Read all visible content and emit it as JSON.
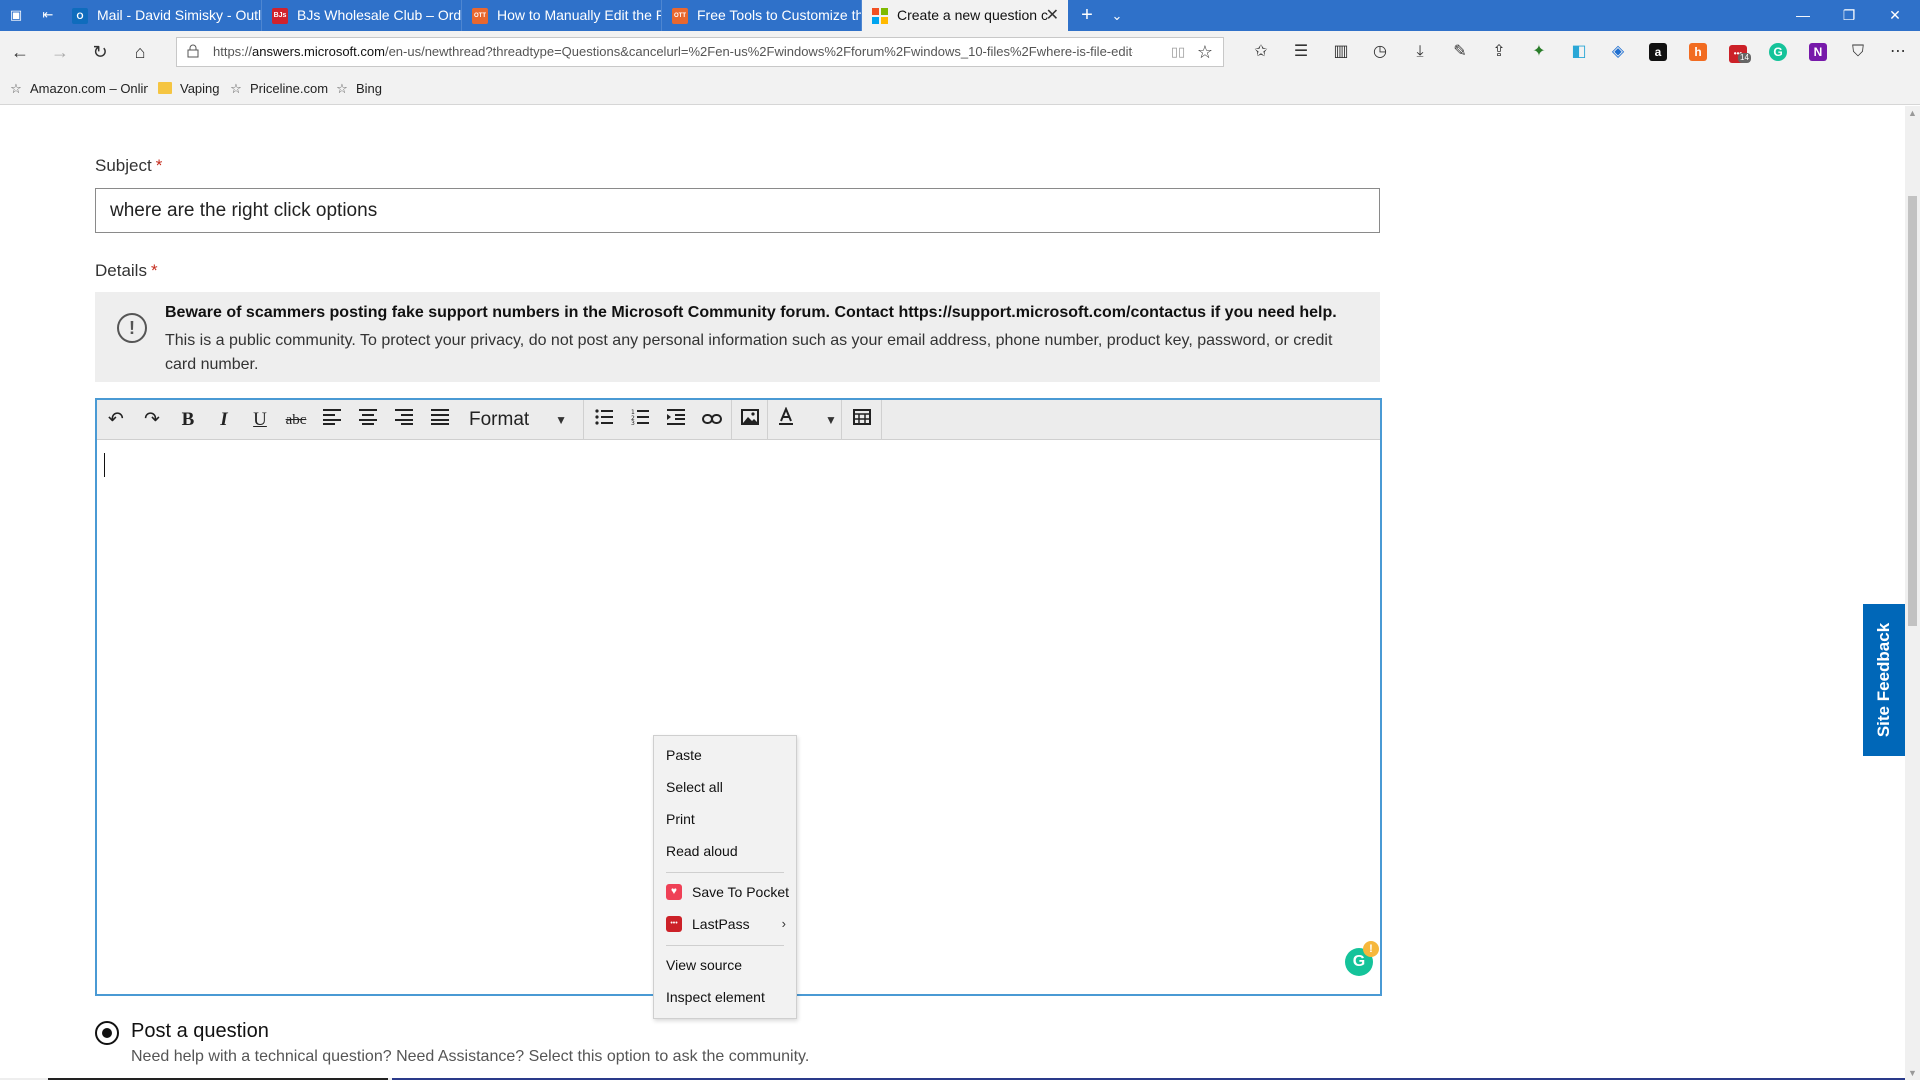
{
  "tabs": [
    {
      "title": "Mail - David Simisky - Outlo",
      "favicon": "outlook-icon",
      "favicon_color": "#0f6cbd",
      "favicon_text": "O"
    },
    {
      "title": "BJs Wholesale Club – Order",
      "favicon": "bjs-icon",
      "favicon_color": "#d0222d",
      "favicon_text": "BJs"
    },
    {
      "title": "How to Manually Edit the Ri",
      "favicon": "ottt-icon",
      "favicon_color": "#e8672e",
      "favicon_text": "OTT"
    },
    {
      "title": "Free Tools to Customize the",
      "favicon": "ottt-icon",
      "favicon_color": "#e8672e",
      "favicon_text": "OTT"
    },
    {
      "title": "Create a new question c",
      "favicon": "microsoft-icon",
      "active": true
    }
  ],
  "address": {
    "url_prefix": "https://",
    "url_domain": "answers.microsoft.com",
    "url_path": "/en-us/newthread?threadtype=Questions&cancelurl=%2Fen-us%2Fwindows%2Fforum%2Fwindows_10-files%2Fwhere-is-file-edit-view"
  },
  "favorites": [
    {
      "label": "Amazon.com – Onlin",
      "icon": "star-icon"
    },
    {
      "label": "Vaping",
      "icon": "folder-icon"
    },
    {
      "label": "Priceline.com",
      "icon": "star-icon"
    },
    {
      "label": "Bing",
      "icon": "star-icon"
    }
  ],
  "form": {
    "subject_label": "Subject",
    "subject_value": "where are the right click options",
    "details_label": "Details",
    "required_mark": "*",
    "notice_bold": "Beware of scammers posting fake support numbers in the Microsoft Community forum. Contact https://support.microsoft.com/contactus if you need help.",
    "notice_body": "This is a public community. To protect your privacy, do not post any personal information such as your email address, phone number, product key, password, or credit card number."
  },
  "toolbar": {
    "format_label": "Format"
  },
  "context_menu": {
    "items": [
      "Paste",
      "Select all",
      "Print",
      "Read aloud"
    ],
    "extensions": [
      "Save To Pocket",
      "LastPass"
    ],
    "dev": [
      "View source",
      "Inspect element"
    ]
  },
  "post_option": {
    "label": "Post a question",
    "description": "Need help with a technical question? Need Assistance? Select this option to ask the community."
  },
  "site_feedback": "Site Feedback",
  "extensions_badge": "14",
  "colors": {
    "tab_bar": "#2f71c9",
    "editor_focus": "#4a9ad4",
    "required": "#c42b1c",
    "feedback_tab": "#0067b8"
  }
}
